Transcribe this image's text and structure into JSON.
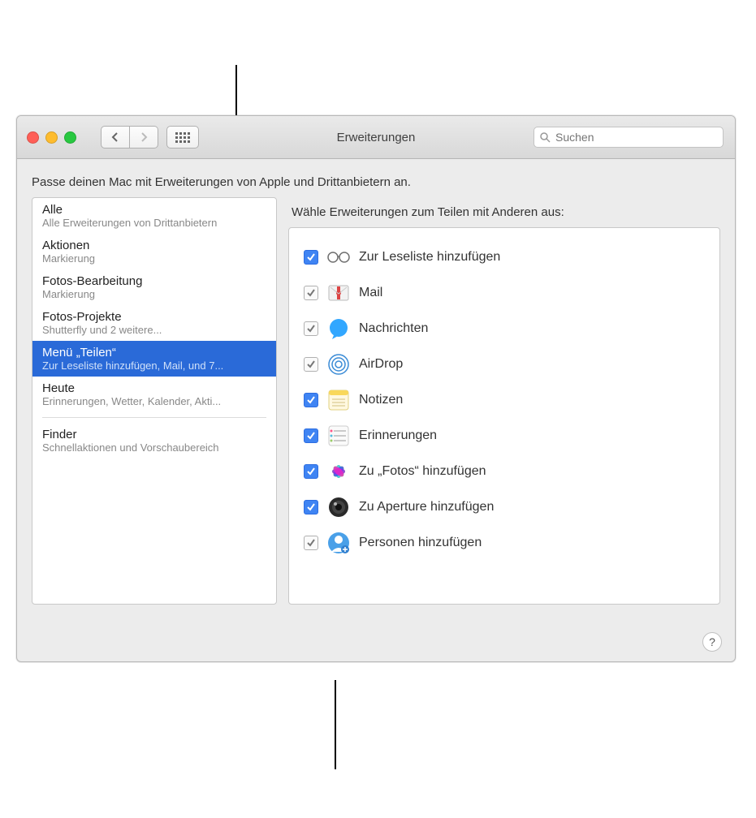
{
  "window": {
    "title": "Erweiterungen",
    "subtitle": "Passe deinen Mac mit Erweiterungen von Apple und Drittanbietern an.",
    "search_placeholder": "Suchen",
    "help_label": "?"
  },
  "sidebar": {
    "items": [
      {
        "label": "Alle",
        "desc": "Alle Erweiterungen von Drittanbietern",
        "selected": false
      },
      {
        "label": "Aktionen",
        "desc": "Markierung",
        "selected": false
      },
      {
        "label": "Fotos-Bearbeitung",
        "desc": "Markierung",
        "selected": false
      },
      {
        "label": "Fotos-Projekte",
        "desc": "Shutterfly und 2 weitere...",
        "selected": false
      },
      {
        "label": "Menü „Teilen“",
        "desc": "Zur Leseliste hinzufügen, Mail, und 7...",
        "selected": true
      },
      {
        "label": "Heute",
        "desc": "Erinnerungen, Wetter, Kalender, Akti...",
        "selected": false
      }
    ],
    "finder": {
      "label": "Finder",
      "desc": "Schnellaktionen und Vorschaubereich"
    }
  },
  "main": {
    "title": "Wähle Erweiterungen zum Teilen mit Anderen aus:",
    "items": [
      {
        "label": "Zur Leseliste hinzufügen",
        "checked": true,
        "blue": true,
        "icon": "glasses"
      },
      {
        "label": "Mail",
        "checked": true,
        "blue": false,
        "icon": "mail"
      },
      {
        "label": "Nachrichten",
        "checked": true,
        "blue": false,
        "icon": "messages"
      },
      {
        "label": "AirDrop",
        "checked": true,
        "blue": false,
        "icon": "airdrop"
      },
      {
        "label": "Notizen",
        "checked": true,
        "blue": true,
        "icon": "notizen"
      },
      {
        "label": "Erinnerungen",
        "checked": true,
        "blue": true,
        "icon": "reminders"
      },
      {
        "label": "Zu „Fotos“ hinzufügen",
        "checked": true,
        "blue": true,
        "icon": "fotos"
      },
      {
        "label": "Zu Aperture hinzufügen",
        "checked": true,
        "blue": true,
        "icon": "aperture"
      },
      {
        "label": "Personen hinzufügen",
        "checked": true,
        "blue": false,
        "icon": "personen"
      }
    ]
  }
}
